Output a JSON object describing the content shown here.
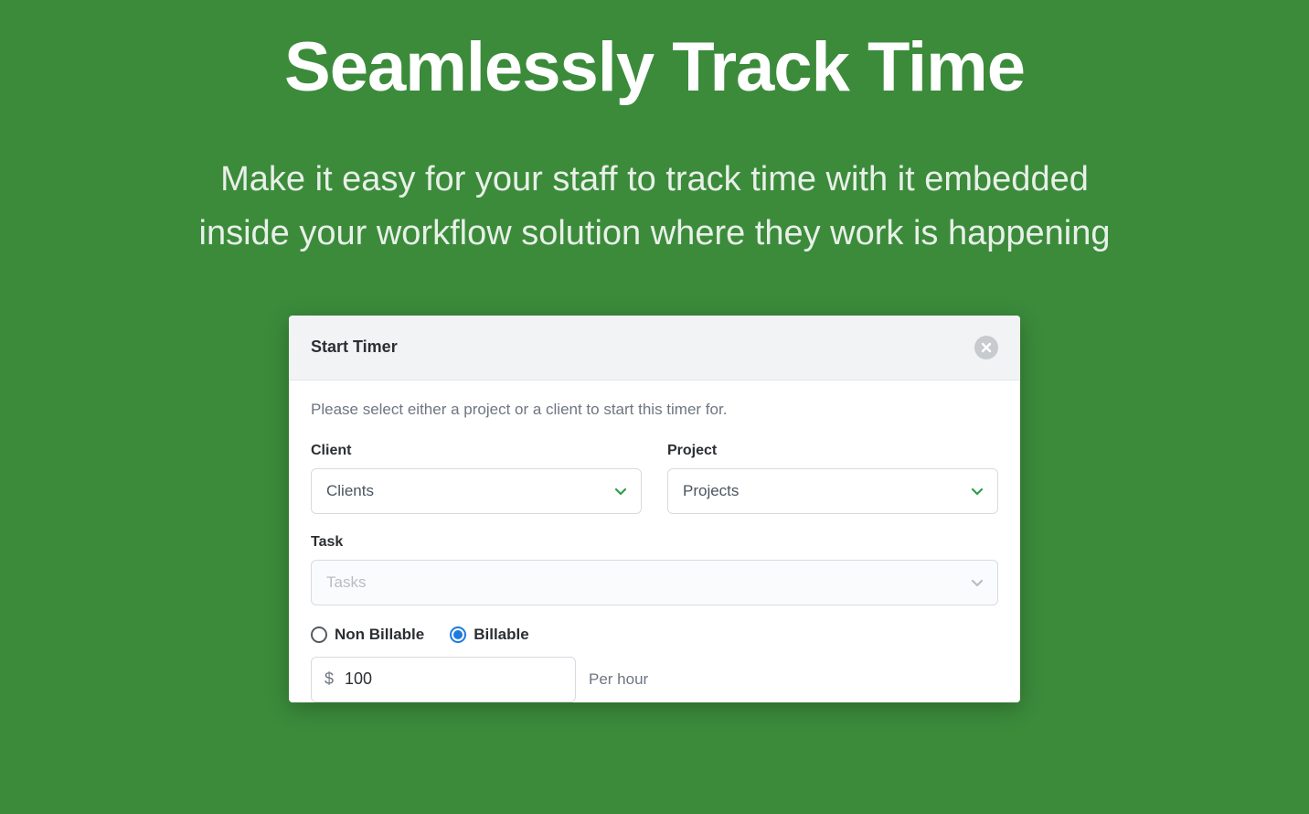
{
  "hero": {
    "title": "Seamlessly Track Time",
    "subtitle": "Make it easy for your staff to track time with it embedded inside your workflow solution where they work is happening"
  },
  "panel": {
    "title": "Start Timer",
    "instruction": "Please select either a project or a client to start this timer for.",
    "client": {
      "label": "Client",
      "value": "Clients"
    },
    "project": {
      "label": "Project",
      "value": "Projects"
    },
    "task": {
      "label": "Task",
      "value": "Tasks"
    },
    "billing": {
      "non_billable_label": "Non Billable",
      "billable_label": "Billable",
      "selected": "billable"
    },
    "rate": {
      "currency_symbol": "$",
      "value": "100",
      "suffix": "Per hour"
    }
  },
  "colors": {
    "page_bg": "#3b8b3b",
    "accent_chevron": "#2e9e4a",
    "radio_active": "#1f7ae0"
  }
}
